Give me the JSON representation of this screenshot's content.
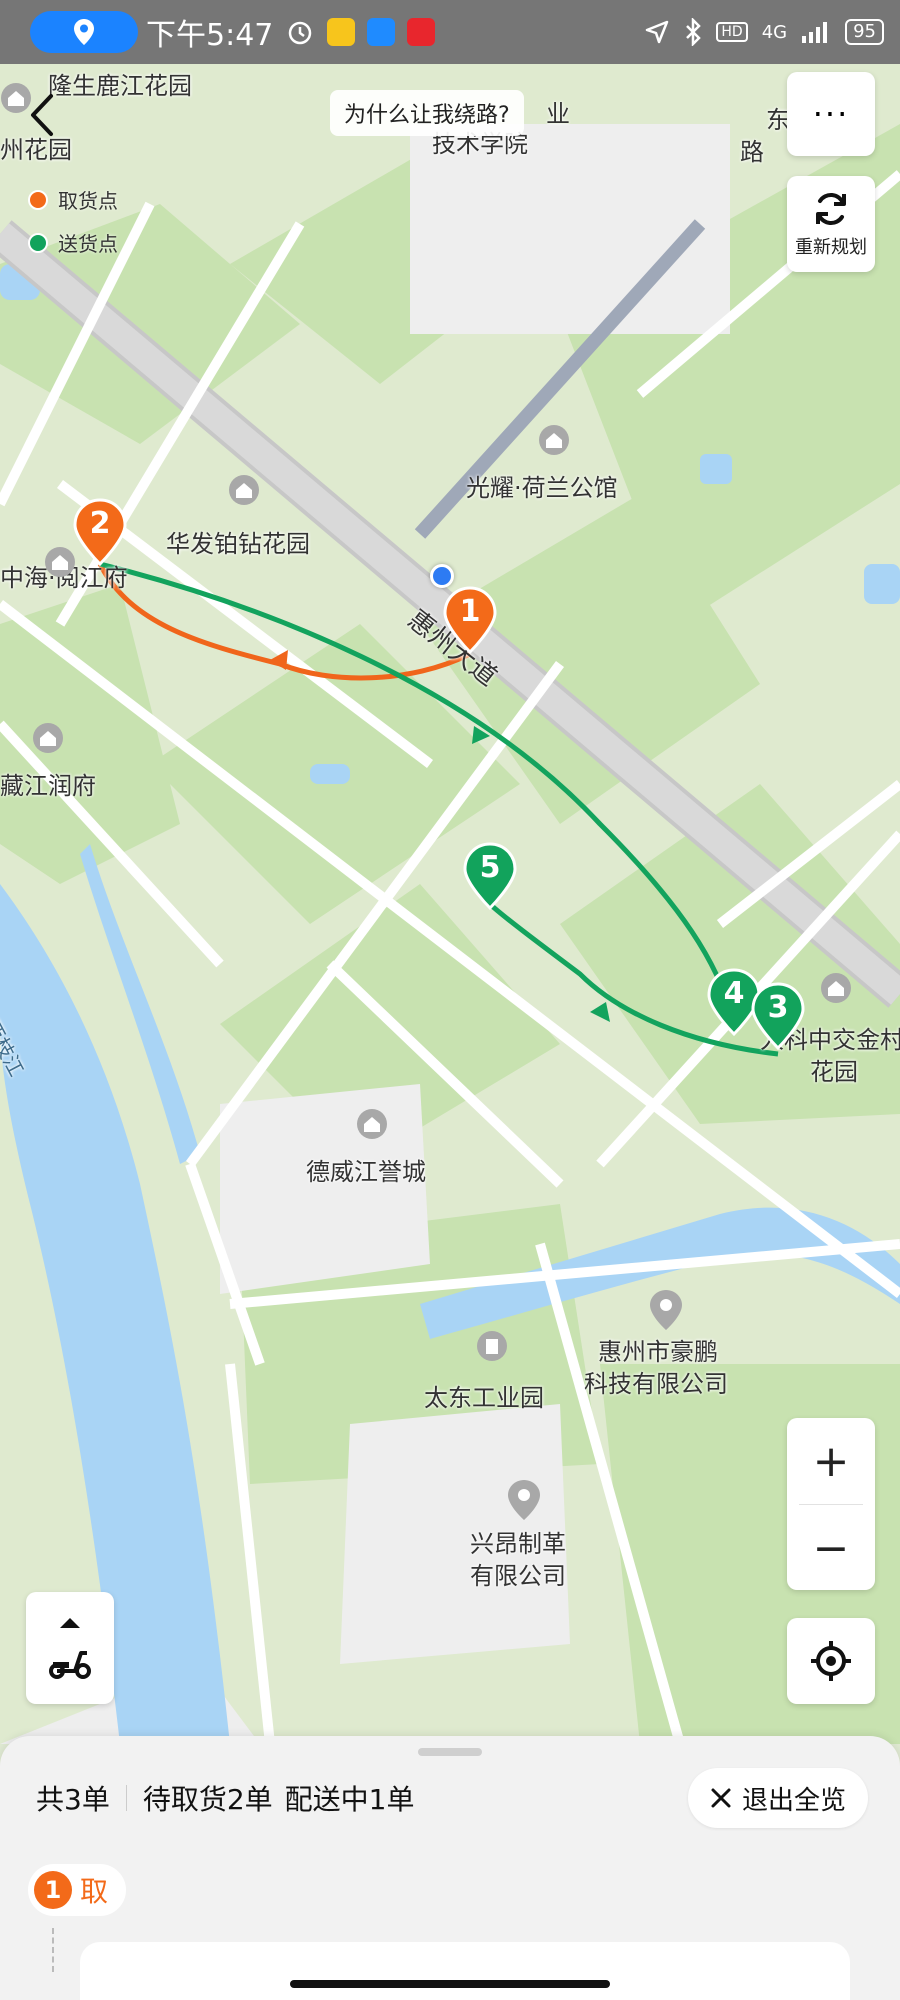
{
  "status_bar": {
    "time": "下午5:47",
    "app_icons": [
      "location-icon",
      "alarm-icon",
      "taobao-icon",
      "message-icon",
      "mall-icon"
    ],
    "network": "4G",
    "hd": "HD",
    "battery": "95"
  },
  "legend": {
    "pickup": "取货点",
    "delivery": "送货点",
    "pickup_color": "#f36a19",
    "delivery_color": "#12a35c"
  },
  "header": {
    "why_detour": "为什么让我绕路?",
    "replan_label": "重新规划"
  },
  "map": {
    "labels": {
      "longsheng": "隆生鹿江花园",
      "zhouhuayuan": "州花园",
      "tech_college_top": "业",
      "tech_college": "技术学院",
      "road_top_right": "东",
      "road_top_right_2": "路",
      "guangyao": "光耀·荷兰公馆",
      "huafa": "华发铂钻花园",
      "zhonghai": "中海·阅江府",
      "huizhou_avenue": "惠州大道",
      "zangjiang": "藏江润府",
      "xizhi_river": "西枝江",
      "kezhongjiao_1": "人科中交金村",
      "kezhongjiao_2": "花园",
      "dewei": "德威江誉城",
      "haopeng_1": "惠州市豪鹏",
      "haopeng_2": "科技有限公司",
      "taidong": "太东工业园",
      "xingang_1": "兴昂制革",
      "xingang_2": "有限公司"
    },
    "markers": [
      {
        "num": "1",
        "kind": "pickup"
      },
      {
        "num": "2",
        "kind": "pickup"
      },
      {
        "num": "3",
        "kind": "delivery"
      },
      {
        "num": "4",
        "kind": "delivery"
      },
      {
        "num": "5",
        "kind": "delivery"
      }
    ]
  },
  "controls": {
    "zoom_in": "+",
    "zoom_out": "−",
    "more": "···"
  },
  "sheet": {
    "total": "共3单",
    "pending_pickup": "待取货2单",
    "delivering": "配送中1单",
    "exit_label": "退出全览",
    "pickup_tag_num": "1",
    "pickup_tag_text": "取"
  }
}
